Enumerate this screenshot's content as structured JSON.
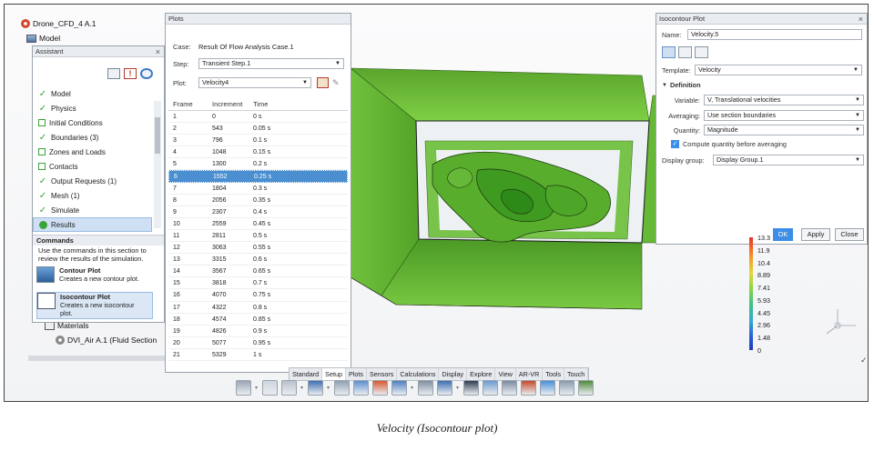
{
  "tree": {
    "root": "Drone_CFD_4 A.1",
    "model": "Model",
    "materials": "Materials",
    "material_item": "DVI_Air A.1 (Fluid Section"
  },
  "assistant": {
    "title": "Assistant",
    "close": "×",
    "steps": [
      {
        "label": "Model",
        "state": "check"
      },
      {
        "label": "Physics",
        "state": "check"
      },
      {
        "label": "Initial Conditions",
        "state": "box"
      },
      {
        "label": "Boundaries (3)",
        "state": "check"
      },
      {
        "label": "Zones and Loads",
        "state": "box"
      },
      {
        "label": "Contacts",
        "state": "box"
      },
      {
        "label": "Output Requests (1)",
        "state": "check"
      },
      {
        "label": "Mesh (1)",
        "state": "check"
      },
      {
        "label": "Simulate",
        "state": "check"
      },
      {
        "label": "Results",
        "state": "dot",
        "selected": true
      }
    ],
    "commands_title": "Commands",
    "commands_desc_line1": "Use the commands in this section to",
    "commands_desc_line2": "review the results of the simulation.",
    "commands": [
      {
        "title": "Contour Plot",
        "desc": "Creates a new contour plot.",
        "desc2": ""
      },
      {
        "title": "Isocontour Plot",
        "desc": "Creates a new isocontour",
        "desc2": "plot."
      }
    ]
  },
  "plots": {
    "title": "Plots",
    "case_label": "Case:",
    "case_value": "Result Of Flow Analysis Case.1",
    "step_label": "Step:",
    "step_value": "Transient Step.1",
    "plot_label": "Plot:",
    "plot_value": "Velocity4",
    "columns": [
      "Frame",
      "Increment",
      "Time"
    ],
    "rows": [
      [
        "1",
        "0",
        "0 s"
      ],
      [
        "2",
        "543",
        "0.05 s"
      ],
      [
        "3",
        "796",
        "0.1 s"
      ],
      [
        "4",
        "1048",
        "0.15 s"
      ],
      [
        "5",
        "1300",
        "0.2 s"
      ],
      [
        "6",
        "1552",
        "0.25 s"
      ],
      [
        "7",
        "1804",
        "0.3 s"
      ],
      [
        "8",
        "2056",
        "0.35 s"
      ],
      [
        "9",
        "2307",
        "0.4 s"
      ],
      [
        "10",
        "2559",
        "0.45 s"
      ],
      [
        "11",
        "2811",
        "0.5 s"
      ],
      [
        "12",
        "3063",
        "0.55 s"
      ],
      [
        "13",
        "3315",
        "0.6 s"
      ],
      [
        "14",
        "3567",
        "0.65 s"
      ],
      [
        "15",
        "3818",
        "0.7 s"
      ],
      [
        "16",
        "4070",
        "0.75 s"
      ],
      [
        "17",
        "4322",
        "0.8 s"
      ],
      [
        "18",
        "4574",
        "0.85 s"
      ],
      [
        "19",
        "4826",
        "0.9 s"
      ],
      [
        "20",
        "5077",
        "0.95 s"
      ],
      [
        "21",
        "5329",
        "1 s"
      ]
    ],
    "selected_row": 5
  },
  "iso": {
    "title": "Isocontour Plot",
    "close": "×",
    "name_label": "Name:",
    "name_value": "Velocity.5",
    "template_label": "Template:",
    "template_value": "Velocity",
    "definition": "Definition",
    "variable_label": "Variable:",
    "variable_value": "V, Translational velocities",
    "averaging_label": "Averaging:",
    "averaging_value": "Use section boundaries",
    "quantity_label": "Quantity:",
    "quantity_value": "Magnitude",
    "checkbox_label": "Compute quantity before averaging",
    "display_group_label": "Display group:",
    "display_group_value": "Display Group.1",
    "ok": "OK",
    "apply": "Apply",
    "close_btn": "Close"
  },
  "legend": {
    "values": [
      "13.3",
      "11.9",
      "10.4",
      "8.89",
      "7.41",
      "5.93",
      "4.45",
      "2.96",
      "1.48",
      "0"
    ]
  },
  "tabs": {
    "items": [
      "Standard",
      "Setup",
      "Plots",
      "Sensors",
      "Calculations",
      "Display",
      "Explore",
      "View",
      "AR-VR",
      "Tools",
      "Touch"
    ],
    "active": "Setup"
  },
  "toolbar_icons": [
    "align-icon",
    "copy-icon",
    "paste-icon",
    "undo-icon",
    "select-icon",
    "view-icon",
    "render-icon",
    "table-icon",
    "mesh-icon",
    "probe-icon",
    "axis-icon",
    "section-icon",
    "clip-icon",
    "sensor-icon",
    "settings-icon",
    "report-icon",
    "plugin-icon"
  ],
  "caption": "Velocity (Isocontour plot)",
  "colors": {
    "accent": "#3d8ee6",
    "selection": "#4b8fd0",
    "check": "#3aa33a",
    "surface_green": "#6cc23a"
  }
}
